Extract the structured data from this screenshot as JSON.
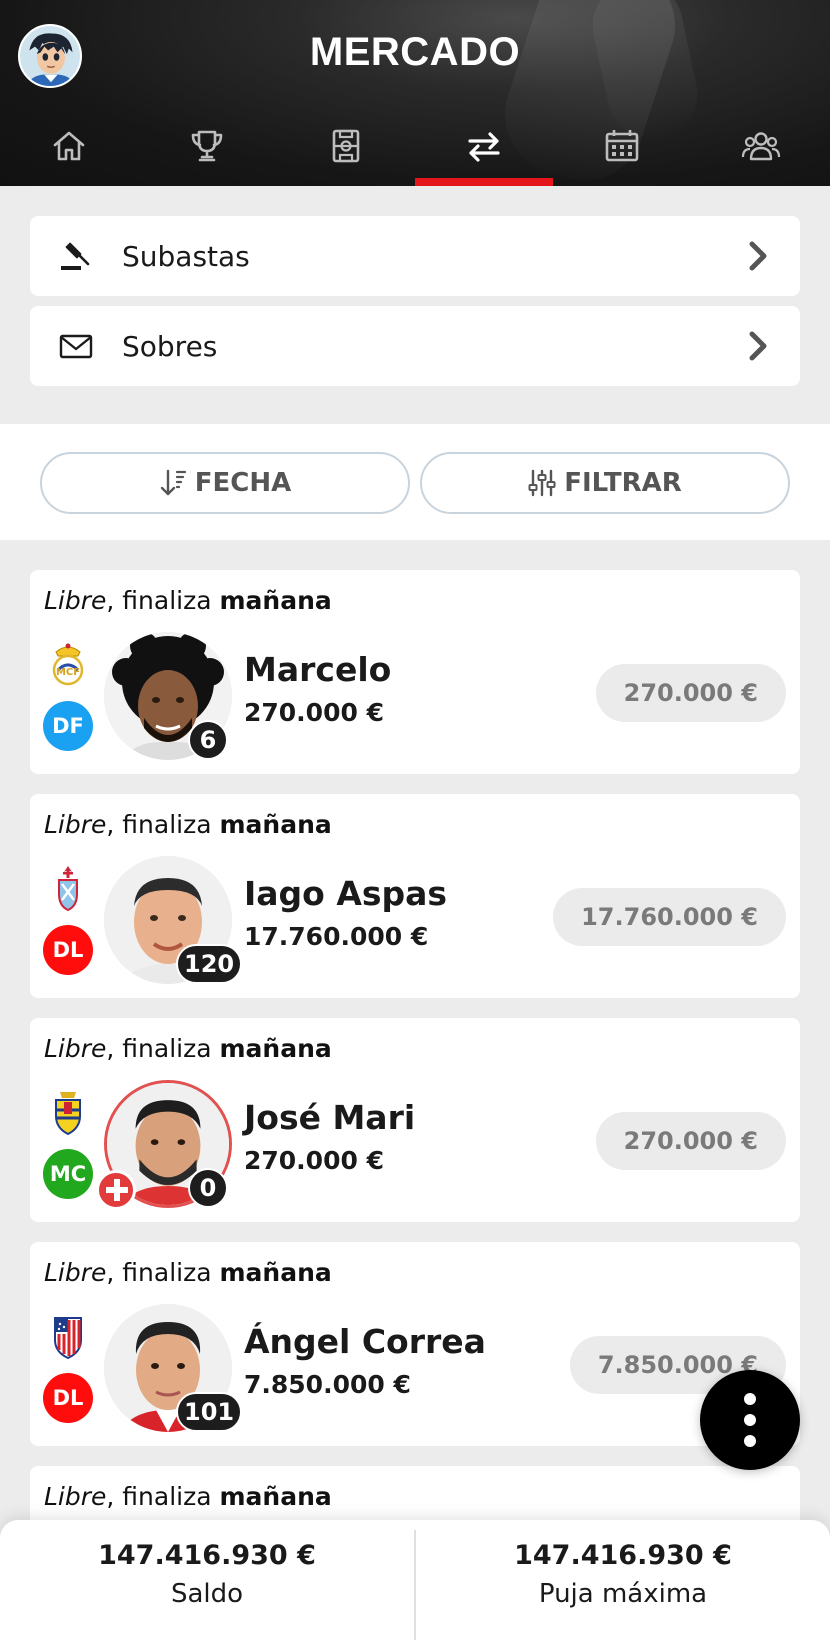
{
  "header": {
    "title": "MERCADO",
    "nav": [
      {
        "icon": "home-icon",
        "active": false
      },
      {
        "icon": "trophy-icon",
        "active": false
      },
      {
        "icon": "lineup-icon",
        "active": false
      },
      {
        "icon": "transfer-icon",
        "active": true
      },
      {
        "icon": "calendar-icon",
        "active": false
      },
      {
        "icon": "users-icon",
        "active": false
      }
    ],
    "accent": "#e4161b"
  },
  "menu": {
    "auctions_label": "Subastas",
    "envelopes_label": "Sobres"
  },
  "sort": {
    "date_label": "FECHA",
    "filter_label": "FILTRAR"
  },
  "players": [
    {
      "status_type": "Libre",
      "status_mid": ", finaliza ",
      "status_when": "mañana",
      "name": "Marcelo",
      "value": "270.000 €",
      "bid": "270.000 €",
      "position": "DF",
      "position_color": "#1ba1f2",
      "points": "6",
      "team": "real-madrid-crest",
      "injured": false
    },
    {
      "status_type": "Libre",
      "status_mid": ", finaliza ",
      "status_when": "mañana",
      "name": "Iago Aspas",
      "value": "17.760.000 €",
      "bid": "17.760.000 €",
      "position": "DL",
      "position_color": "#ff0d0d",
      "points": "120",
      "team": "celta-crest",
      "injured": false
    },
    {
      "status_type": "Libre",
      "status_mid": ", finaliza ",
      "status_when": "mañana",
      "name": "José Mari",
      "value": "270.000 €",
      "bid": "270.000 €",
      "position": "MC",
      "position_color": "#21a81e",
      "points": "0",
      "team": "cadiz-crest",
      "injured": true
    },
    {
      "status_type": "Libre",
      "status_mid": ", finaliza ",
      "status_when": "mañana",
      "name": "Ángel Correa",
      "value": "7.850.000 €",
      "bid": "7.850.000 €",
      "position": "DL",
      "position_color": "#ff0d0d",
      "points": "101",
      "team": "atletico-crest",
      "injured": false
    },
    {
      "status_type": "Libre",
      "status_mid": ", finaliza ",
      "status_when": "mañana"
    }
  ],
  "footer": {
    "balance_value": "147.416.930 €",
    "balance_label": "Saldo",
    "maxbid_value": "147.416.930 €",
    "maxbid_label": "Puja máxima"
  }
}
